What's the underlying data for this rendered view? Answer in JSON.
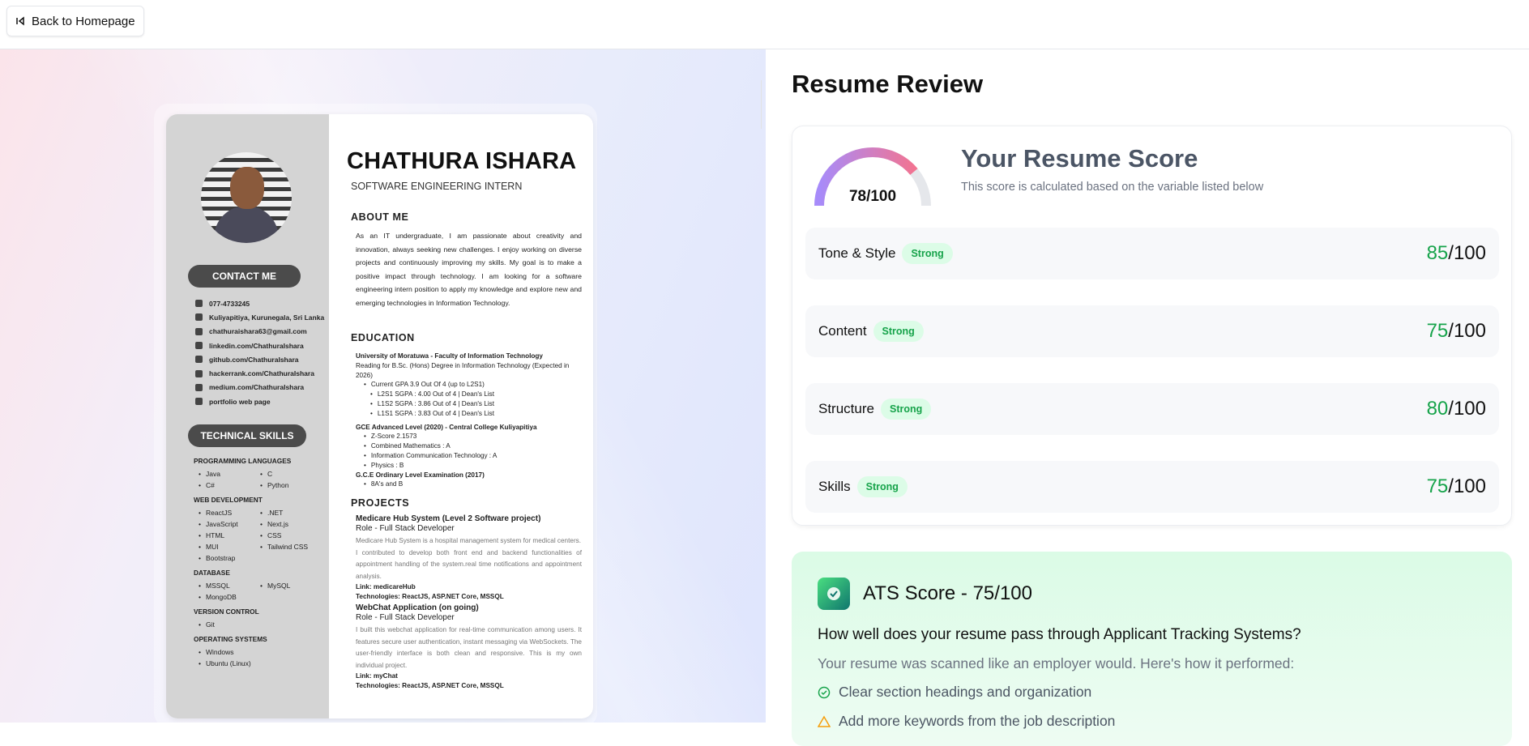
{
  "top": {
    "back_label": "Back to Homepage"
  },
  "resume": {
    "name": "CHATHURA ISHARA",
    "role": "SOFTWARE ENGINEERING INTERN",
    "contact_heading": "CONTACT ME",
    "contacts": [
      "077-4733245",
      "Kuliyapitiya, Kurunegala, Sri Lanka",
      "chathuraishara63@gmail.com",
      "linkedin.com/ChathuraIshara",
      "github.com/ChathuraIshara",
      "hackerrank.com/ChathuraIshara",
      "medium.com/ChathuraIshara",
      "portfolio web page"
    ],
    "skills_heading": "TECHNICAL SKILLS",
    "skill_groups": [
      {
        "title": "PROGRAMMING LANGUAGES",
        "items": [
          "Java",
          "C",
          "C#",
          "Python"
        ]
      },
      {
        "title": "WEB  DEVELOPMENT",
        "items": [
          "ReactJS",
          ".NET",
          "JavaScript",
          "Next.js",
          "HTML",
          "CSS",
          "MUI",
          "Tailwind CSS",
          "Bootstrap"
        ]
      },
      {
        "title": "DATABASE",
        "items": [
          "MSSQL",
          "MySQL",
          "MongoDB"
        ]
      },
      {
        "title": "VERSION CONTROL",
        "items": [
          "Git"
        ]
      },
      {
        "title": "OPERATING SYSTEMS",
        "items": [
          "Windows",
          "Ubuntu (Linux)"
        ]
      }
    ],
    "about_heading": "ABOUT ME",
    "about_text": "As an IT undergraduate, I am passionate about creativity and innovation, always seeking new challenges. I enjoy working on diverse projects and continuously improving my skills. My goal is to make a positive impact through technology. I am looking for a software engineering intern position to apply my knowledge and explore new and emerging technologies in Information Technology.",
    "education_heading": "EDUCATION",
    "edu1_title": "University of Moratuwa - Faculty of Information Technology",
    "edu1_desc": "Reading for B.Sc. (Hons) Degree in Information Technology (Expected in 2026)",
    "edu1_items": [
      "Current GPA 3.9 Out Of 4 (up to L2S1)",
      "L2S1 SGPA : 4.00 Out of 4 | Dean's List",
      "L1S2 SGPA : 3.86 Out of 4 | Dean's List",
      "L1S1 SGPA : 3.83 Out of 4 | Dean's List"
    ],
    "edu2_title": "GCE Advanced Level (2020) - Central College Kuliyapitiya",
    "edu2_items": [
      "Z-Score 2.1573",
      "Combined Mathematics : A",
      "Information Communication Technology : A",
      "Physics : B"
    ],
    "edu3_title": "G.C.E Ordinary Level Examination (2017)",
    "edu3_items": [
      "8A's and B"
    ],
    "projects_heading": "PROJECTS",
    "proj1_title": "Medicare Hub System (Level 2 Software project)",
    "proj1_role": "Role - Full Stack Developer",
    "proj1_desc1": "Medicare Hub System is a hospital management system for medical centers.",
    "proj1_desc2": "I contributed to develop both front end and backend functionalities of appointment handling of the system.real time notifications and appointment analysis.",
    "proj1_link": "Link: medicareHub",
    "proj1_tech": "Technologies: ReactJS, ASP.NET Core, MSSQL",
    "proj2_title": "WebChat Application (on going)",
    "proj2_role": "Role - Full Stack Developer",
    "proj2_desc": "I built this webchat application for real-time communication among users. It features secure user authentication, instant messaging via WebSockets. The user-friendly interface is both clean and responsive. This is my own individual project.",
    "proj2_link": "Link: myChat",
    "proj2_tech": "Technologies: ReactJS, ASP.NET Core, MSSQL"
  },
  "review": {
    "title": "Resume Review",
    "score_label": "78/100",
    "score_value": 78,
    "score_title": "Your Resume Score",
    "score_sub": "This score is calculated based on the variable listed below",
    "categories": [
      {
        "name": "Tone & Style",
        "badge": "Strong",
        "score": "85",
        "total": "/100"
      },
      {
        "name": "Content",
        "badge": "Strong",
        "score": "75",
        "total": "/100"
      },
      {
        "name": "Structure",
        "badge": "Strong",
        "score": "80",
        "total": "/100"
      },
      {
        "name": "Skills",
        "badge": "Strong",
        "score": "75",
        "total": "/100"
      }
    ],
    "ats_title": "ATS Score - 75/100",
    "ats_question": "How well does your resume pass through Applicant Tracking Systems?",
    "ats_desc": "Your resume was scanned like an employer would. Here's how it performed:",
    "ats_items": [
      {
        "icon": "check-circle-icon",
        "text": "Clear section headings and organization"
      },
      {
        "icon": "warning-icon",
        "text": "Add more keywords from the job description"
      }
    ]
  },
  "colors": {
    "accent_green": "#16a34a",
    "gauge_start": "#a78bfa",
    "gauge_end": "#fb7185"
  }
}
